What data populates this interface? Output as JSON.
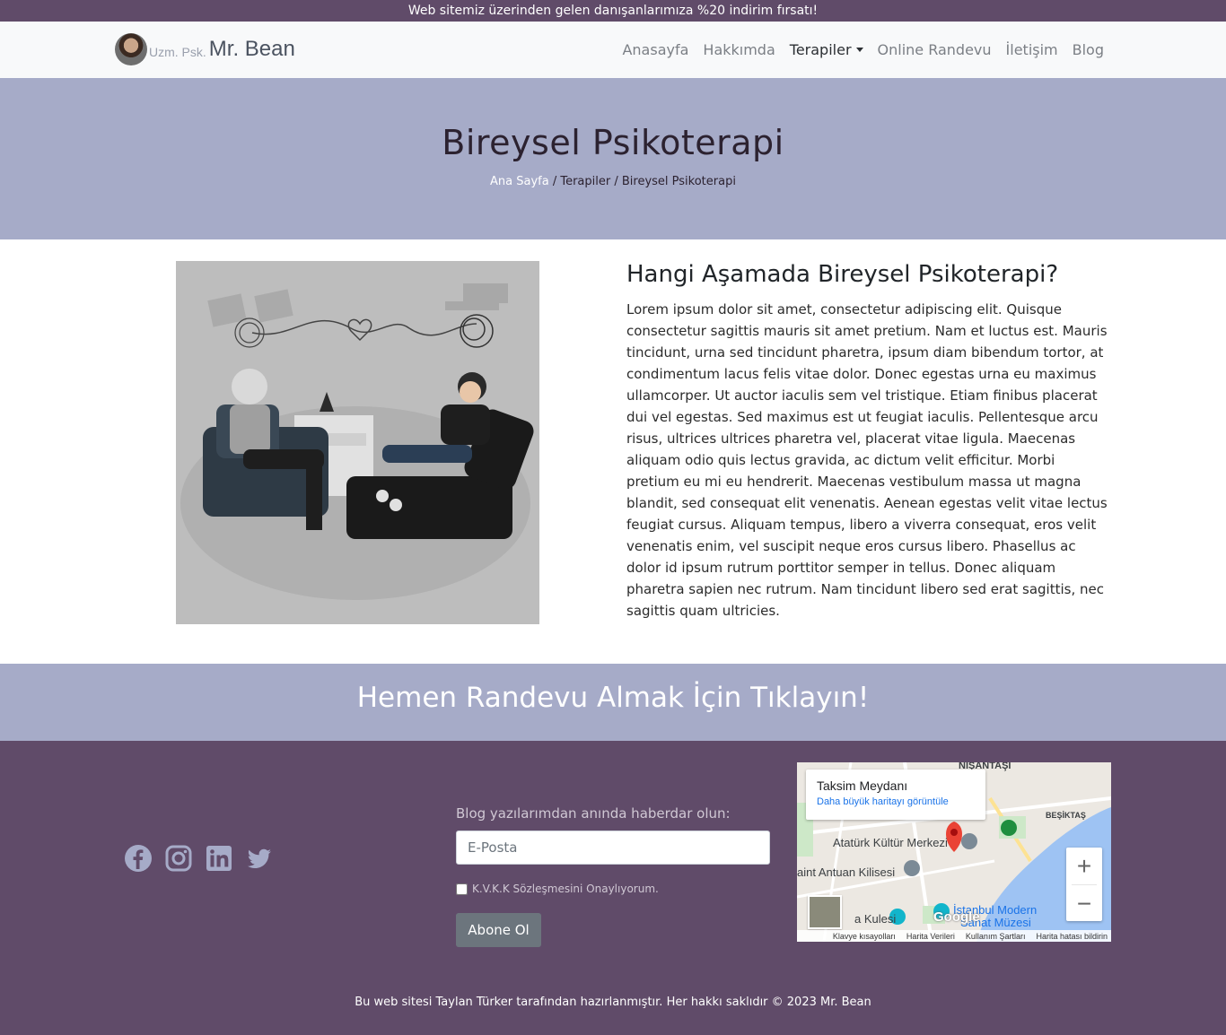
{
  "topbar": {
    "announcement": "Web sitemiz üzerinden gelen danışanlarımıza %20 indirim fırsatı!"
  },
  "brand": {
    "prefix": "Uzm. Psk.",
    "name": "Mr. Bean"
  },
  "nav": {
    "items": [
      {
        "label": "Anasayfa"
      },
      {
        "label": "Hakkımda"
      },
      {
        "label": "Terapiler"
      },
      {
        "label": "Online Randevu"
      },
      {
        "label": "İletişim"
      },
      {
        "label": "Blog"
      }
    ]
  },
  "hero": {
    "title": "Bireysel Psikoterapi",
    "breadcrumb": {
      "home": "Ana Sayfa",
      "sep1": " / ",
      "parent": "Terapiler",
      "sep2": " / ",
      "current": "Bireysel Psikoterapi"
    }
  },
  "content": {
    "heading": "Hangi Aşamada Bireysel Psikoterapi?",
    "body": "Lorem ipsum dolor sit amet, consectetur adipiscing elit. Quisque consectetur sagittis mauris sit amet pretium. Nam et luctus est. Mauris tincidunt, urna sed tincidunt pharetra, ipsum diam bibendum tortor, at condimentum lacus felis vitae dolor. Donec egestas urna eu maximus ullamcorper. Ut auctor iaculis sem vel tristique. Etiam finibus placerat dui vel egestas. Sed maximus est ut feugiat iaculis. Pellentesque arcu risus, ultrices ultrices pharetra vel, placerat vitae ligula. Maecenas aliquam odio quis lectus gravida, ac dictum velit efficitur. Morbi pretium eu mi eu hendrerit. Maecenas vestibulum massa ut magna blandit, sed consequat elit venenatis. Aenean egestas velit vitae lectus feugiat cursus. Aliquam tempus, libero a viverra consequat, eros velit venenatis enim, vel suscipit neque eros cursus libero. Phasellus ac dolor id ipsum rutrum porttitor semper in tellus. Donec aliquam pharetra sapien nec rutrum. Nam tincidunt libero sed erat sagittis, nec sagittis quam ultricies."
  },
  "cta": {
    "label": "Hemen Randevu Almak İçin Tıklayın!"
  },
  "footer": {
    "socials": [
      {
        "icon": "facebook-icon"
      },
      {
        "icon": "instagram-icon"
      },
      {
        "icon": "linkedin-icon"
      },
      {
        "icon": "twitter-icon"
      }
    ],
    "newsletter": {
      "label": "Blog yazılarımdan anında haberdar olun:",
      "placeholder": "E-Posta",
      "consent": "K.V.K.K Sözleşmesini Onaylıyorum.",
      "button": "Abone Ol"
    },
    "map": {
      "place": "Taksim Meydanı",
      "larger_map": "Daha büyük haritayı görüntüle",
      "labels": {
        "nisantasi": "NIŞANTAŞI",
        "besiktas": "BEŞİKTAŞ",
        "akm": "Atatürk Kültür Merkezi",
        "antuan": "aint Antuan Kilisesi",
        "kulesi": "a Kulesi",
        "modern": "İstanbul Modern",
        "sanat": "Sanat Müzesi"
      },
      "zoom_in": "+",
      "zoom_out": "−",
      "google": "Google",
      "footer_links": [
        "Klavye kısayolları",
        "Harita Verileri",
        "Kullanım Şartları",
        "Harita hatası bildirin"
      ]
    },
    "copyright": "Bu web sitesi Taylan Türker tarafından hazırlanmıştır. Her hakkı saklıdır © 2023 Mr. Bean"
  },
  "colors": {
    "purple": "#604b69",
    "lavender": "#a6abc8",
    "nav_bg": "#f8f9fa",
    "button_gray": "#6c757d"
  }
}
